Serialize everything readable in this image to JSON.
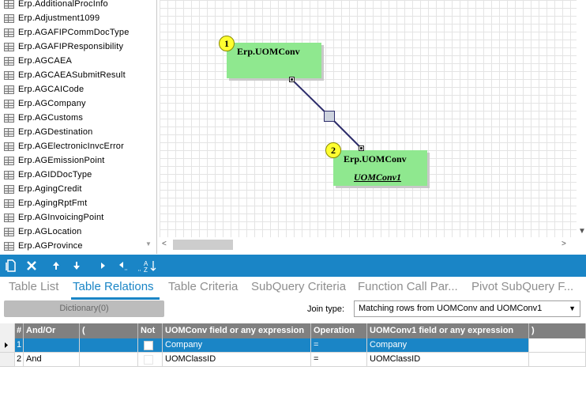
{
  "table_list": [
    "Erp.AdditionalProcInfo",
    "Erp.Adjustment1099",
    "Erp.AGAFIPCommDocType",
    "Erp.AGAFIPResponsibility",
    "Erp.AGCAEA",
    "Erp.AGCAEASubmitResult",
    "Erp.AGCAICode",
    "Erp.AGCompany",
    "Erp.AGCustoms",
    "Erp.AGDestination",
    "Erp.AGElectronicInvcError",
    "Erp.AGEmissionPoint",
    "Erp.AGIDDocType",
    "Erp.AgingCredit",
    "Erp.AgingRptFmt",
    "Erp.AGInvoicingPoint",
    "Erp.AGLocation",
    "Erp.AGProvince"
  ],
  "diagram": {
    "node1": {
      "badge": "1",
      "table": "Erp.UOMConv",
      "alias": ""
    },
    "node2": {
      "badge": "2",
      "table": "Erp.UOMConv",
      "alias": "UOMConv1"
    }
  },
  "toolbar": {
    "icons": [
      "new-icon",
      "delete-icon",
      "move-up-icon",
      "move-down-icon",
      "move-right-icon",
      "move-left-icon",
      "sort-icon"
    ]
  },
  "tabs": {
    "items": [
      "Table List",
      "Table Relations",
      "Table Criteria",
      "SubQuery Criteria",
      "Function Call Par...",
      "Pivot SubQuery F..."
    ],
    "active": "Table Relations"
  },
  "dictionary_button": "Dictionary(0)",
  "join": {
    "label": "Join type:",
    "value": "Matching rows from UOMConv and UOMConv1"
  },
  "grid": {
    "headers": {
      "num": "#",
      "and_or": "And/Or",
      "open_paren": "(",
      "not": "Not",
      "left_field": "UOMConv field or any expression",
      "operation": "Operation",
      "right_field": "UOMConv1 field or any expression",
      "close_paren": ")"
    },
    "rows": [
      {
        "num": "1",
        "and_or": "",
        "open_paren": "",
        "left_field": "Company",
        "operation": "=",
        "right_field": "Company",
        "close_paren": ""
      },
      {
        "num": "2",
        "and_or": "And",
        "open_paren": "",
        "left_field": "UOMClassID",
        "operation": "=",
        "right_field": "UOMClassID",
        "close_paren": ""
      }
    ]
  },
  "colors": {
    "accent": "#1a85c6",
    "node_fill": "#8fe88f",
    "badge_fill": "#ffff30",
    "link_line": "#2c2c6a"
  }
}
